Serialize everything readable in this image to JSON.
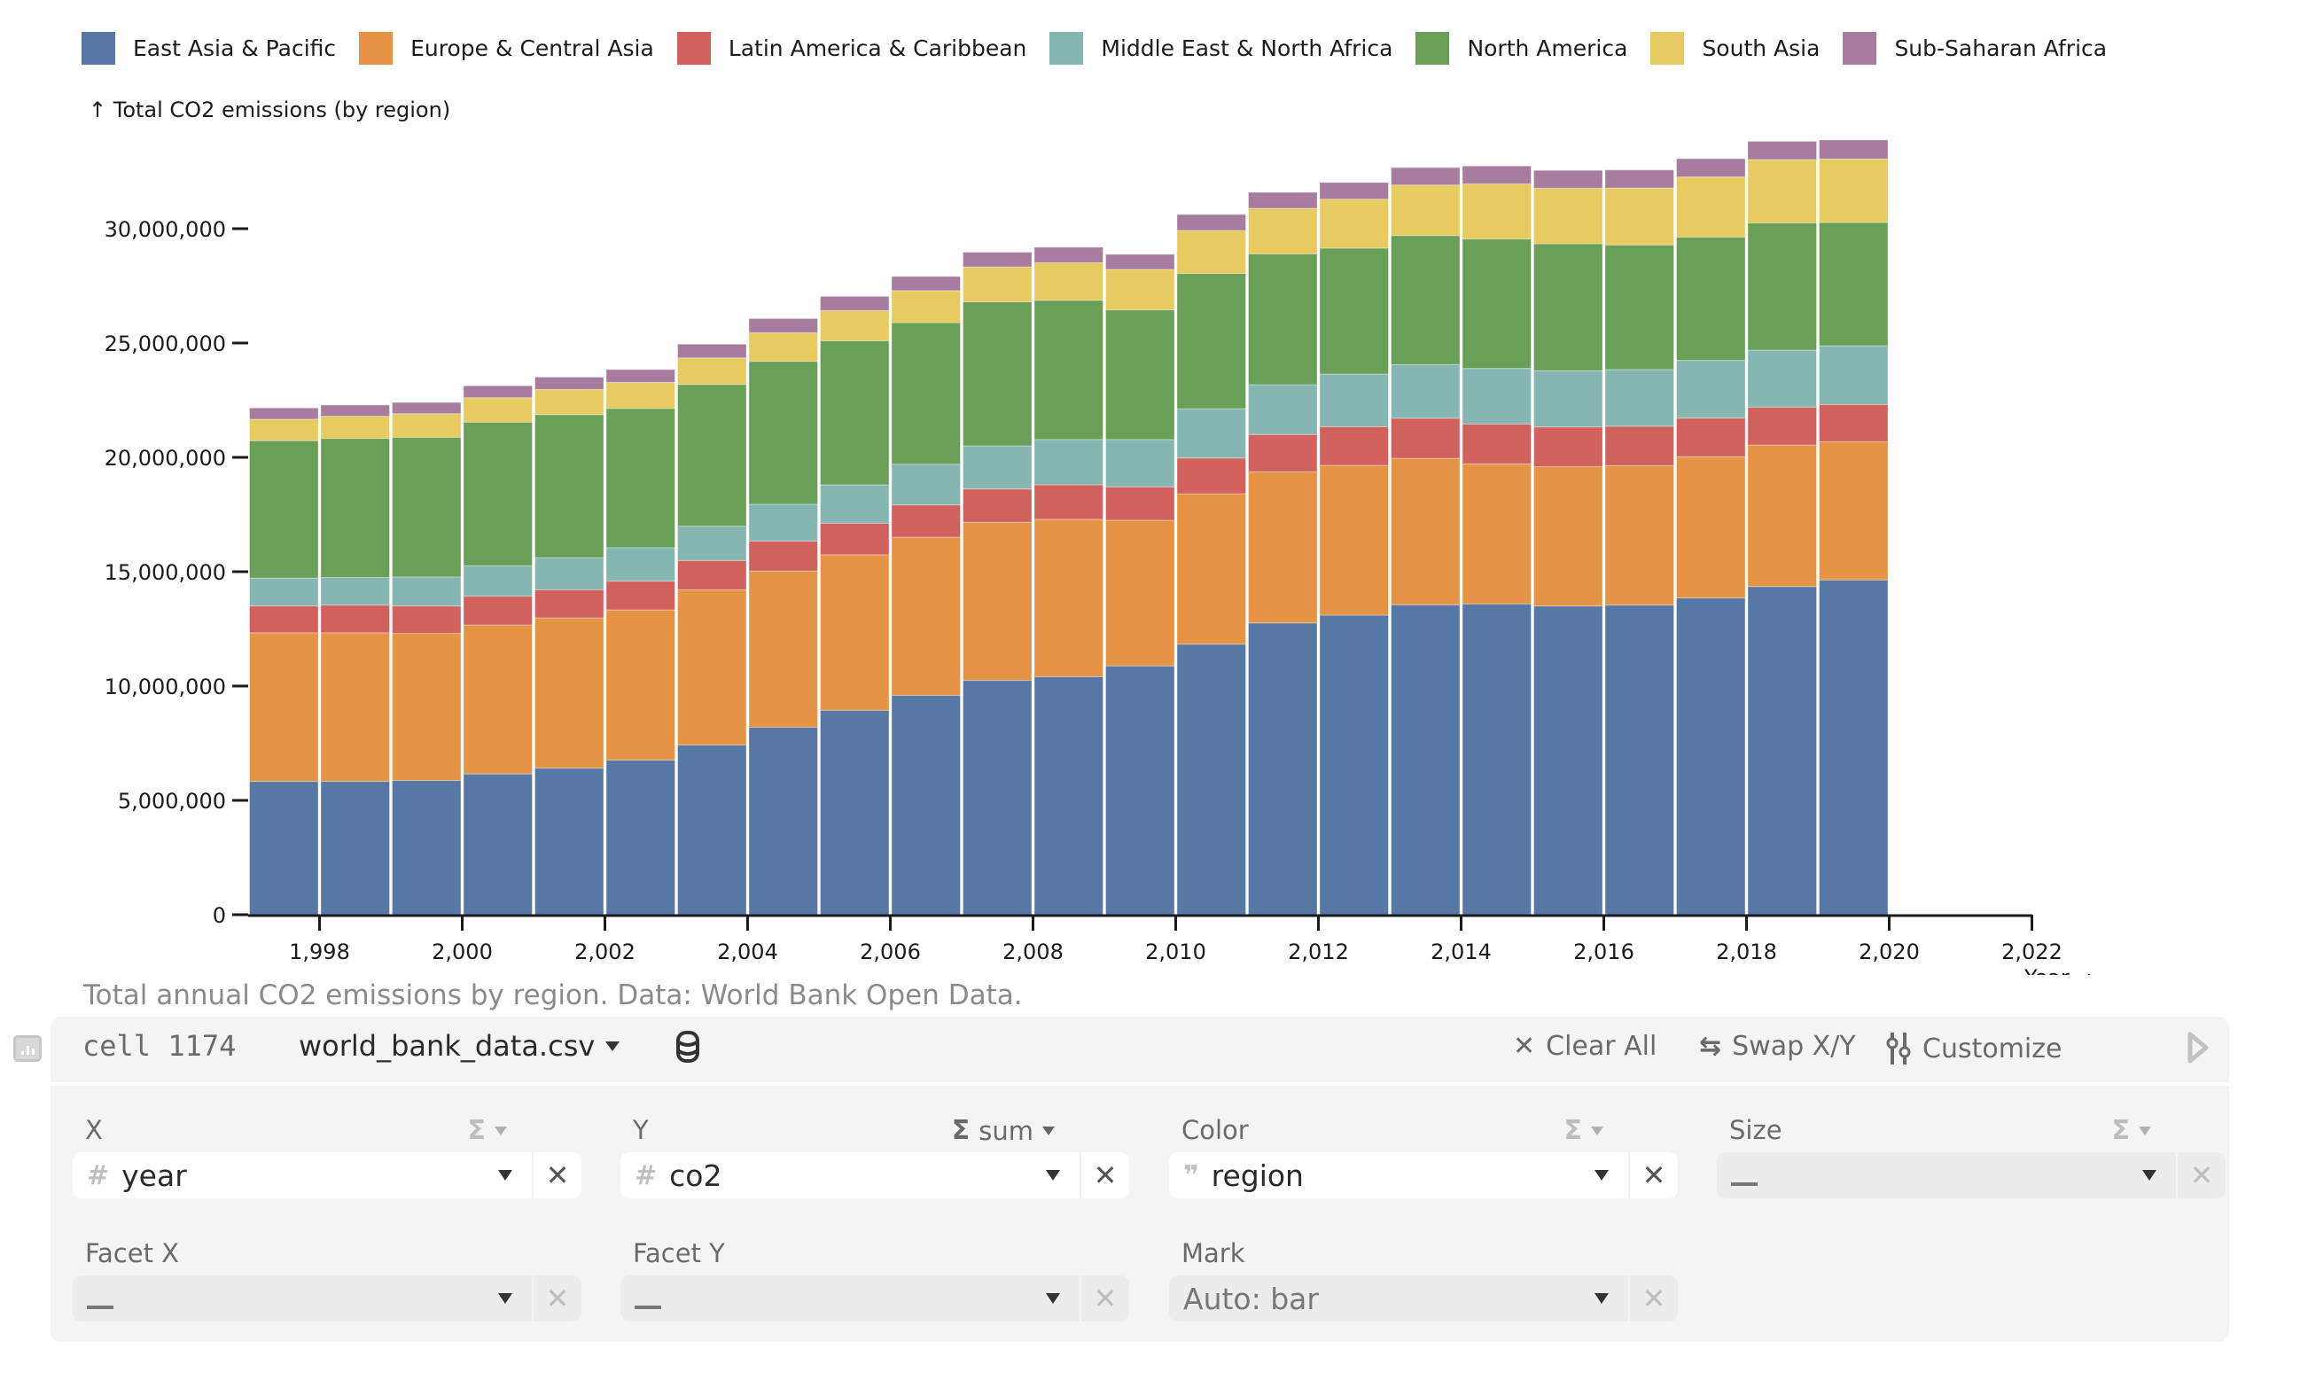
{
  "legend": [
    {
      "label": "East Asia & Pacific",
      "color": "#5778a4"
    },
    {
      "label": "Europe & Central Asia",
      "color": "#e49444"
    },
    {
      "label": "Latin America & Caribbean",
      "color": "#d1615d"
    },
    {
      "label": "Middle East & North Africa",
      "color": "#85b6b2"
    },
    {
      "label": "North America",
      "color": "#6a9f58"
    },
    {
      "label": "South Asia",
      "color": "#e7ca60"
    },
    {
      "label": "Sub-Saharan Africa",
      "color": "#a87c9f"
    }
  ],
  "chart_data": {
    "type": "bar",
    "stacked": true,
    "title": "",
    "ylabel": "↑ Total CO2 emissions (by region)",
    "xlabel": "Year →",
    "ylim": [
      0,
      34000000
    ],
    "xlim": [
      1997,
      2022
    ],
    "y_ticks": [
      0,
      5000000,
      10000000,
      15000000,
      20000000,
      25000000,
      30000000
    ],
    "y_tick_labels": [
      "0",
      "5,000,000",
      "10,000,000",
      "15,000,000",
      "20,000,000",
      "25,000,000",
      "30,000,000"
    ],
    "x_ticks": [
      1998,
      2000,
      2002,
      2004,
      2006,
      2008,
      2010,
      2012,
      2014,
      2016,
      2018,
      2020,
      2022
    ],
    "x_tick_labels": [
      "1,998",
      "2,000",
      "2,002",
      "2,004",
      "2,006",
      "2,008",
      "2,010",
      "2,012",
      "2,014",
      "2,016",
      "2,018",
      "2,020",
      "2,022"
    ],
    "grid": false,
    "legend_position": "top-left",
    "categories": [
      1997,
      1998,
      1999,
      2000,
      2001,
      2002,
      2003,
      2004,
      2005,
      2006,
      2007,
      2008,
      2009,
      2010,
      2011,
      2012,
      2013,
      2014,
      2015,
      2016,
      2017,
      2018,
      2019
    ],
    "series": [
      {
        "name": "East Asia & Pacific",
        "values": [
          5830000,
          5830000,
          5870000,
          6160000,
          6410000,
          6760000,
          7420000,
          8200000,
          8940000,
          9590000,
          10250000,
          10410000,
          10880000,
          11830000,
          12760000,
          13100000,
          13550000,
          13590000,
          13500000,
          13540000,
          13850000,
          14350000,
          14640000
        ]
      },
      {
        "name": "Europe & Central Asia",
        "values": [
          6500000,
          6500000,
          6430000,
          6510000,
          6570000,
          6570000,
          6790000,
          6830000,
          6800000,
          6920000,
          6910000,
          6880000,
          6370000,
          6580000,
          6610000,
          6550000,
          6410000,
          6130000,
          6090000,
          6100000,
          6180000,
          6190000,
          6040000
        ]
      },
      {
        "name": "Latin America & Caribbean",
        "values": [
          1170000,
          1210000,
          1200000,
          1260000,
          1230000,
          1260000,
          1280000,
          1310000,
          1380000,
          1410000,
          1460000,
          1510000,
          1460000,
          1560000,
          1630000,
          1690000,
          1750000,
          1740000,
          1740000,
          1720000,
          1690000,
          1660000,
          1630000
        ]
      },
      {
        "name": "Middle East & North Africa",
        "values": [
          1220000,
          1210000,
          1270000,
          1330000,
          1400000,
          1460000,
          1500000,
          1610000,
          1680000,
          1780000,
          1880000,
          1980000,
          2070000,
          2160000,
          2180000,
          2300000,
          2350000,
          2430000,
          2460000,
          2480000,
          2520000,
          2490000,
          2570000
        ]
      },
      {
        "name": "North America",
        "values": [
          6010000,
          6080000,
          6110000,
          6280000,
          6260000,
          6090000,
          6200000,
          6250000,
          6300000,
          6190000,
          6300000,
          6090000,
          5670000,
          5910000,
          5720000,
          5510000,
          5640000,
          5660000,
          5550000,
          5450000,
          5390000,
          5560000,
          5390000
        ]
      },
      {
        "name": "South Asia",
        "values": [
          940000,
          970000,
          1030000,
          1070000,
          1100000,
          1140000,
          1160000,
          1250000,
          1320000,
          1400000,
          1530000,
          1640000,
          1770000,
          1880000,
          1990000,
          2140000,
          2210000,
          2410000,
          2430000,
          2490000,
          2630000,
          2770000,
          2780000
        ]
      },
      {
        "name": "Sub-Saharan Africa",
        "values": [
          490000,
          490000,
          490000,
          520000,
          540000,
          560000,
          600000,
          620000,
          620000,
          620000,
          640000,
          680000,
          660000,
          700000,
          700000,
          730000,
          760000,
          780000,
          780000,
          790000,
          800000,
          800000,
          830000
        ]
      }
    ],
    "caption": "Total annual CO2 emissions by region. Data: World Bank Open Data."
  },
  "panel": {
    "cell_label": "cell 1174",
    "dataset": "world_bank_data.csv",
    "buttons": {
      "clear_all": "Clear All",
      "swap": "Swap X/Y",
      "customize": "Customize"
    },
    "fields": {
      "x": {
        "label": "X",
        "value": "year",
        "type_icon": "#",
        "agg": ""
      },
      "y": {
        "label": "Y",
        "value": "co2",
        "type_icon": "#",
        "agg": "sum"
      },
      "color": {
        "label": "Color",
        "value": "region",
        "type_icon": "❞",
        "agg": ""
      },
      "size": {
        "label": "Size",
        "value": "—",
        "agg": ""
      },
      "facet_x": {
        "label": "Facet X",
        "value": "—"
      },
      "facet_y": {
        "label": "Facet Y",
        "value": "—"
      },
      "mark": {
        "label": "Mark",
        "value": "Auto: bar"
      }
    }
  }
}
